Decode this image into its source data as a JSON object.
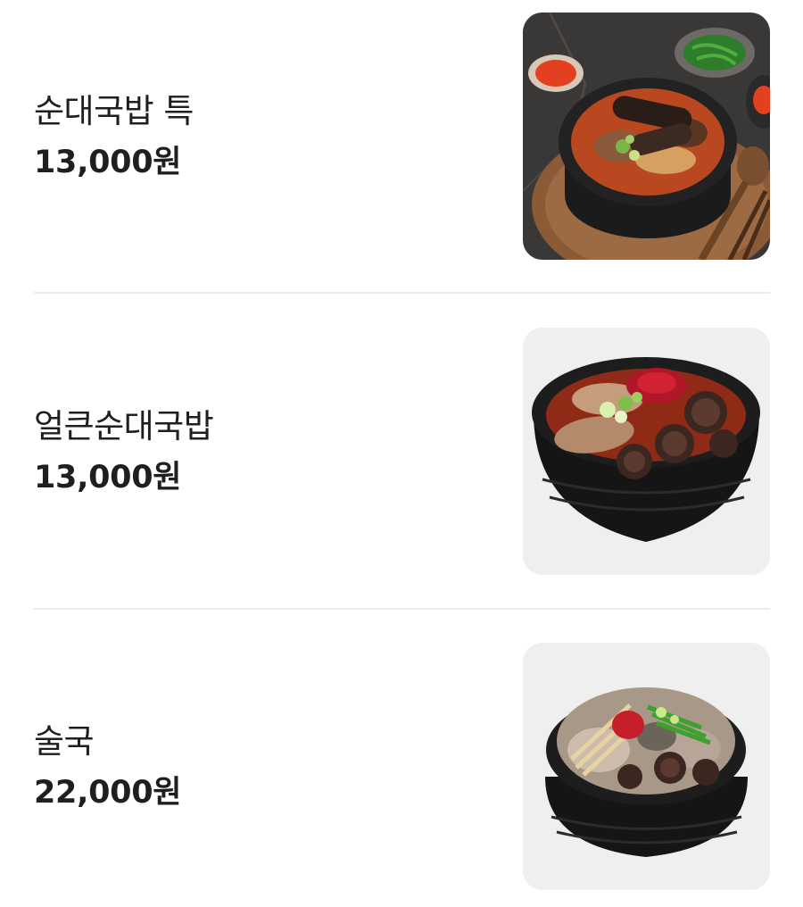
{
  "menu": {
    "items": [
      {
        "name": "순대국밥 특",
        "price": "13,000원"
      },
      {
        "name": "얼큰순대국밥",
        "price": "13,000원"
      },
      {
        "name": "술국",
        "price": "22,000원"
      }
    ]
  },
  "colors": {
    "text": "#1f1f1f",
    "divider": "#ececec",
    "image_background": "#efefef",
    "dark_table": "#3a3837",
    "wood_board": "#8b5a36",
    "broth_red": "#b9471f",
    "earthen_pot": "#161616"
  }
}
